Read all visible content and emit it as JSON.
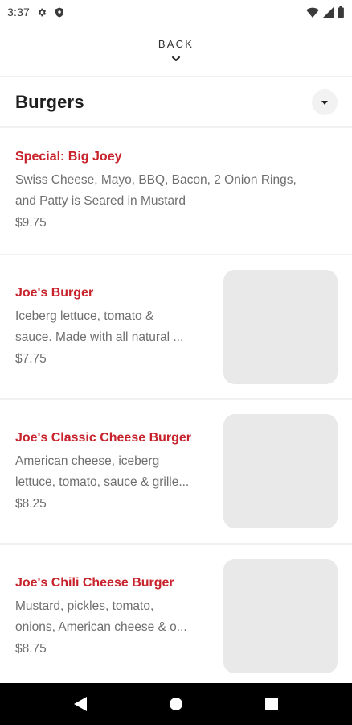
{
  "status_bar": {
    "time": "3:37",
    "icons": [
      "gear-icon",
      "shield-icon",
      "wifi-icon",
      "signal-icon",
      "battery-icon"
    ]
  },
  "header": {
    "back_label": "BACK"
  },
  "category": {
    "title": "Burgers"
  },
  "menu_items": [
    {
      "name": "Special: Big Joey",
      "description_lines": [
        "Swiss Cheese, Mayo, BBQ, Bacon, 2 Onion Rings,",
        "and Patty is Seared in Mustard"
      ],
      "price": "$9.75",
      "has_image": false
    },
    {
      "name": "Joe's Burger",
      "description_lines": [
        "Iceberg lettuce, tomato &",
        "sauce. Made with all natural ..."
      ],
      "price": "$7.75",
      "has_image": true
    },
    {
      "name": "Joe's Classic Cheese Burger",
      "description_lines": [
        "American cheese, iceberg",
        "lettuce, tomato, sauce & grille..."
      ],
      "price": "$8.25",
      "has_image": true
    },
    {
      "name": "Joe's Chili Cheese Burger",
      "description_lines": [
        "Mustard, pickles, tomato,",
        "onions, American cheese & o..."
      ],
      "price": "$8.75",
      "has_image": true
    }
  ],
  "colors": {
    "accent": "#c8232c",
    "text_secondary": "#6f6f6f",
    "image_placeholder": "#e9e9e9",
    "nav_bar": "#000000"
  },
  "nav_bar": {
    "icons": [
      "back-triangle-icon",
      "home-circle-icon",
      "recents-square-icon"
    ]
  }
}
